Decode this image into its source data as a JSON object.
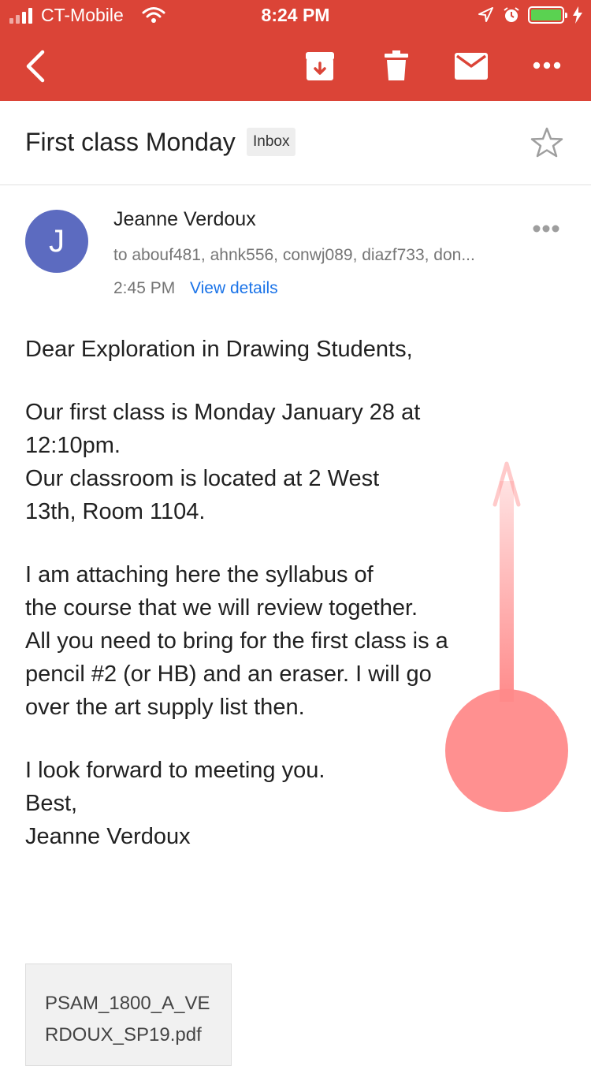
{
  "status_bar": {
    "carrier": "CT-Mobile",
    "time": "8:24 PM"
  },
  "toolbar": {
    "back_icon": "back-arrow-icon",
    "archive_icon": "archive-icon",
    "delete_icon": "trash-icon",
    "mark_unread_icon": "envelope-icon",
    "more_icon": "more-horizontal-icon"
  },
  "email": {
    "subject": "First class Monday",
    "label": "Inbox",
    "sender": {
      "initial": "J",
      "name": "Jeanne Verdoux",
      "avatar_color": "#5c6bc0"
    },
    "recipients": "to abouf481, ahnk556, conwj089, diazf733, don...",
    "sent_time": "2:45 PM",
    "view_details_label": "View details",
    "body": {
      "greeting": "Dear Exploration in Drawing Students,",
      "p1_line1": "Our first class is Monday January 28 at",
      "p1_line2": "12:10pm.",
      "p1_line3": "Our classroom is located at 2 West",
      "p1_line4": "13th, Room 1104.",
      "p2_line1": "I am attaching here the syllabus of",
      "p2_line2": "the course that we will review together.",
      "p2_line3": "All you need to bring for the first class is a",
      "p2_line4": "pencil #2 (or HB) and an eraser. I will go",
      "p2_line5": "over the art supply list then.",
      "closing1": "I look forward to meeting you.",
      "closing2": "Best,",
      "signature": "Jeanne Verdoux"
    },
    "attachment": {
      "name_line1": "PSAM_1800_A_VE",
      "name_line2": "RDOUX_SP19.pdf"
    }
  },
  "colors": {
    "header": "#db4437",
    "link": "#1a73e8",
    "gesture": "#ff8a8a"
  }
}
